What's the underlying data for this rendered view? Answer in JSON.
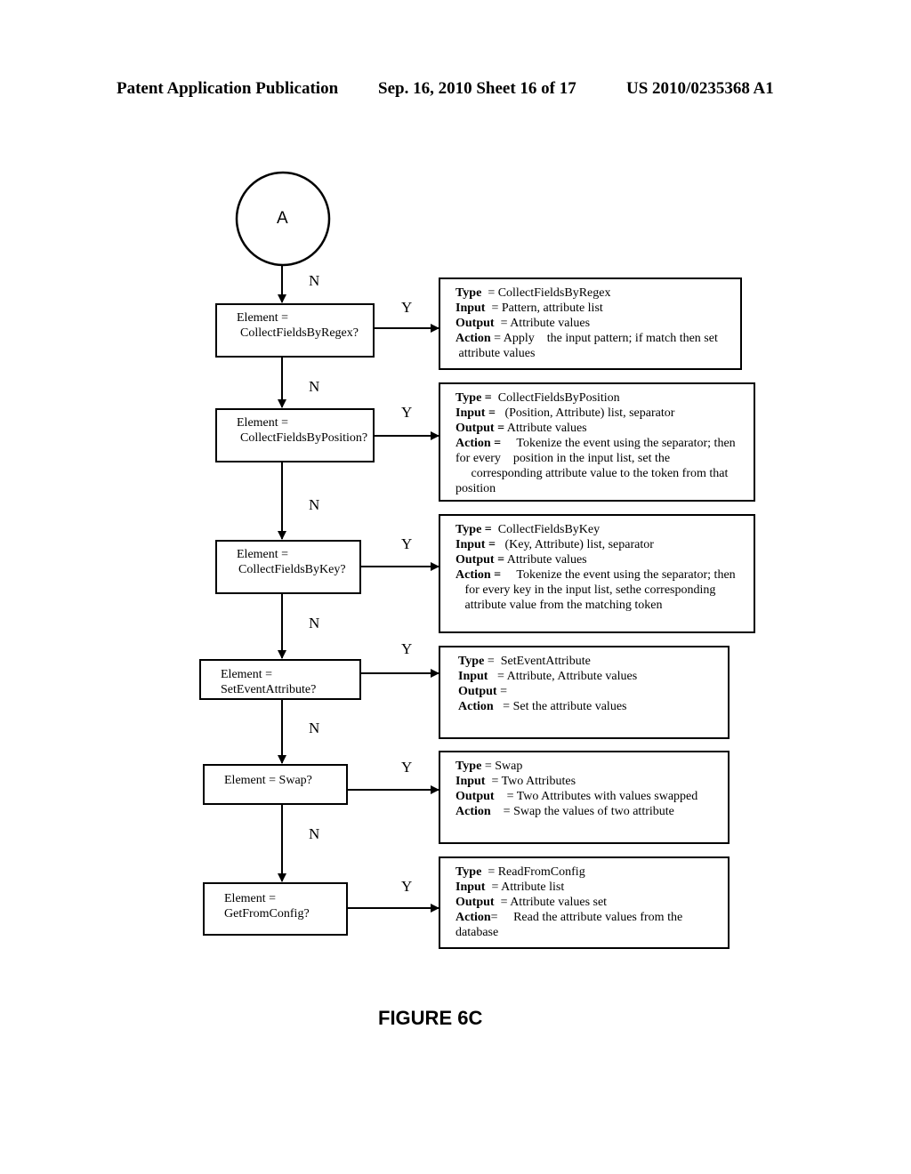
{
  "header": {
    "left": "Patent Application Publication",
    "middle": "Sep. 16, 2010   Sheet 16 of 17",
    "right": "US 2010/0235368 A1"
  },
  "connector": {
    "label": "A"
  },
  "branch_labels": {
    "no": "N",
    "yes": "Y"
  },
  "decisions": [
    {
      "line1": "Element =",
      "line2": "CollectFieldsByRegex?"
    },
    {
      "line1": "Element =",
      "line2": "CollectFieldsByPosition?"
    },
    {
      "line1": "Element =",
      "line2": "CollectFieldsByKey?"
    },
    {
      "line1": "Element =",
      "line2": "SetEventAttribute?"
    },
    {
      "line1": "Element = Swap?",
      "line2": ""
    },
    {
      "line1": "Element =",
      "line2": "GetFromConfig?"
    }
  ],
  "actions": [
    {
      "type_key": "Type",
      "type_val": "  = CollectFieldsByRegex",
      "input_key": "Input",
      "input_val": "  = Pattern, attribute list",
      "output_key": "Output",
      "output_val": "  = Attribute values",
      "action_key": "Action",
      "action_val": " = Apply    the input pattern; if match then set",
      "extra": [
        " attribute values"
      ]
    },
    {
      "type_key": "Type =",
      "type_val": "  CollectFieldsByPosition",
      "input_key": "Input =",
      "input_val": "   (Position, Attribute) list, separator",
      "output_key": "Output =",
      "output_val": " Attribute values",
      "action_key": "Action =",
      "action_val": "     Tokenize the event using the separator; then",
      "extra": [
        "for every    position in the input list, set the",
        "     corresponding attribute value to the token from that",
        "position"
      ]
    },
    {
      "type_key": "Type =",
      "type_val": "  CollectFieldsByKey",
      "input_key": "Input =",
      "input_val": "   (Key, Attribute) list, separator",
      "output_key": "Output =",
      "output_val": " Attribute values",
      "action_key": "Action =",
      "action_val": "     Tokenize the event using the separator; then",
      "extra": [
        "   for every key in the input list, sethe corresponding",
        "   attribute value from the matching token"
      ]
    },
    {
      "type_key": "Type",
      "type_val": " =  SetEventAttribute",
      "input_key": "Input",
      "input_val": "   = Attribute, Attribute values",
      "output_key": "Output",
      "output_val": " =",
      "action_key": "Action",
      "action_val": "   = Set the attribute values",
      "extra": []
    },
    {
      "type_key": "Type",
      "type_val": " = Swap",
      "input_key": "Input",
      "input_val": "  = Two Attributes",
      "output_key": "Output",
      "output_val": "    = Two Attributes with values swapped",
      "action_key": "Action",
      "action_val": "    = Swap the values of two attribute",
      "extra": []
    },
    {
      "type_key": "Type",
      "type_val": "  = ReadFromConfig",
      "input_key": "Input",
      "input_val": "  = Attribute list",
      "output_key": "Output",
      "output_val": "  = Attribute values set",
      "action_key": "Action",
      "action_val": "=     Read the attribute values from the",
      "extra": [
        "database"
      ]
    }
  ],
  "figure_label": "FIGURE 6C"
}
